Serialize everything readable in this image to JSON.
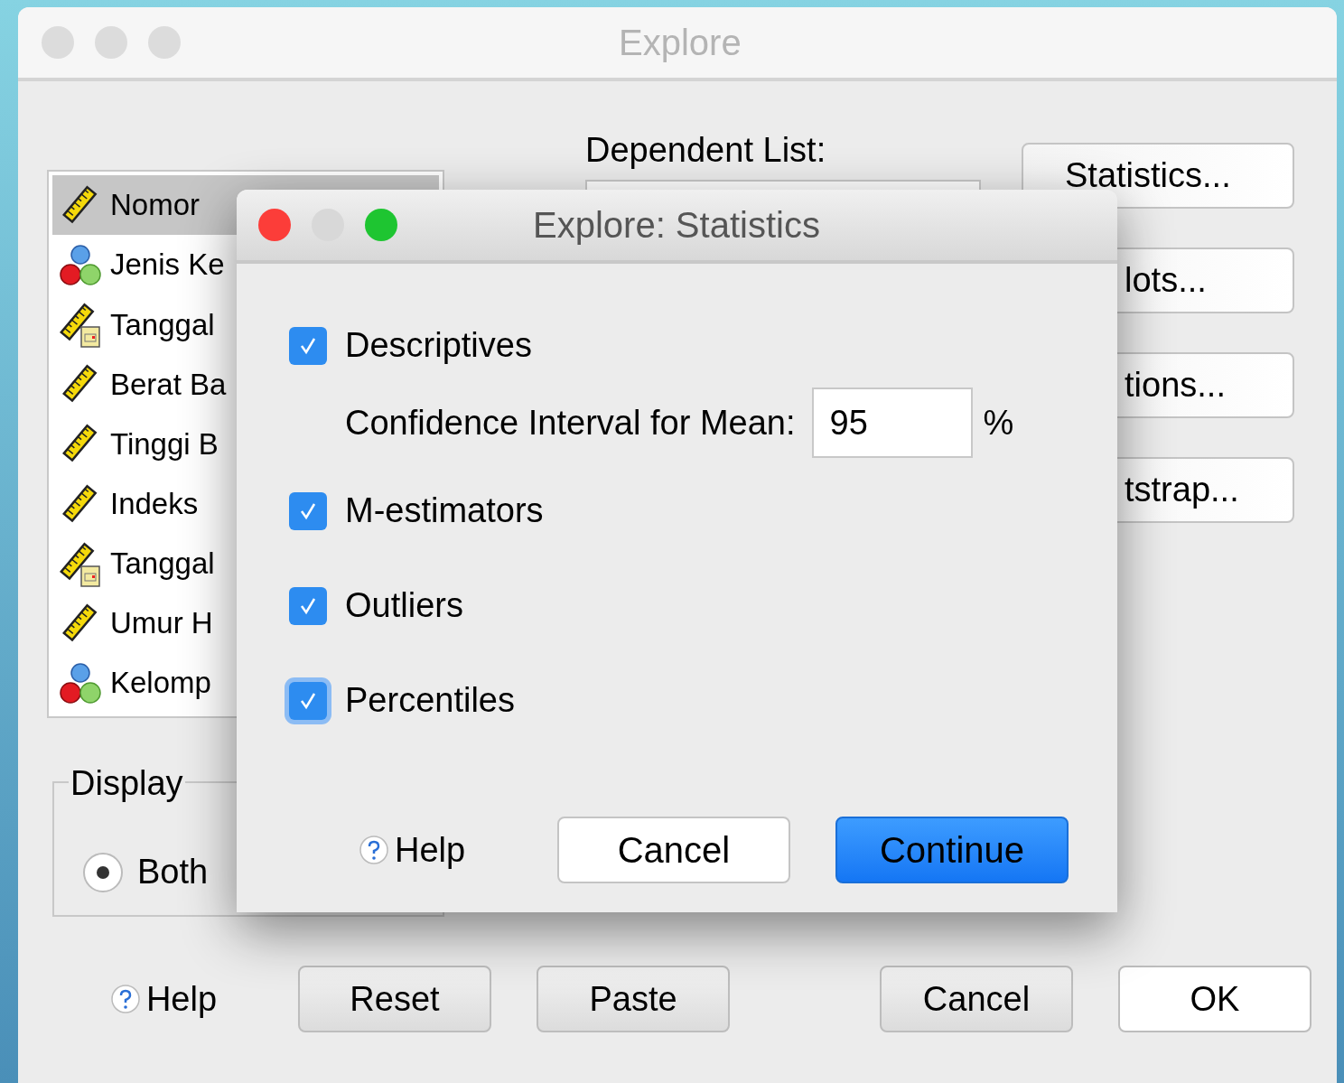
{
  "explore_window": {
    "title": "Explore",
    "variables": [
      {
        "name": "Nomor",
        "kind": "scale",
        "selected": true
      },
      {
        "name": "Jenis Ke",
        "kind": "nominal",
        "selected": false
      },
      {
        "name": "Tanggal",
        "kind": "date",
        "selected": false
      },
      {
        "name": "Berat Ba",
        "kind": "scale",
        "selected": false
      },
      {
        "name": "Tinggi B",
        "kind": "scale",
        "selected": false
      },
      {
        "name": "Indeks",
        "kind": "scale",
        "selected": false
      },
      {
        "name": "Tanggal",
        "kind": "date",
        "selected": false
      },
      {
        "name": "Umur H",
        "kind": "scale",
        "selected": false
      },
      {
        "name": "Kelomp",
        "kind": "nominal",
        "selected": false
      }
    ],
    "dependent_list": {
      "label": "Dependent List:"
    },
    "side_buttons": [
      "Statistics...",
      "lots...",
      "tions...",
      "tstrap..."
    ],
    "display": {
      "legend": "Display",
      "options": [
        {
          "label": "Both",
          "selected": true
        }
      ]
    },
    "buttons": [
      {
        "label": "Help",
        "kind": "help"
      },
      {
        "label": "Reset",
        "kind": "normal"
      },
      {
        "label": "Paste",
        "kind": "normal"
      },
      {
        "label": "Cancel",
        "kind": "normal"
      },
      {
        "label": "OK",
        "kind": "default"
      }
    ]
  },
  "statistics_dialog": {
    "title": "Explore: Statistics",
    "options": [
      {
        "label": "Descriptives",
        "checked": true,
        "focused": false
      },
      {
        "label": "M-estimators",
        "checked": true,
        "focused": false
      },
      {
        "label": "Outliers",
        "checked": true,
        "focused": false
      },
      {
        "label": "Percentiles",
        "checked": true,
        "focused": true
      }
    ],
    "confidence_interval": {
      "label": "Confidence Interval for Mean:",
      "value": "95",
      "unit": "%"
    },
    "buttons": [
      {
        "label": "Help",
        "kind": "help"
      },
      {
        "label": "Cancel",
        "kind": "normal"
      },
      {
        "label": "Continue",
        "kind": "default"
      }
    ]
  }
}
